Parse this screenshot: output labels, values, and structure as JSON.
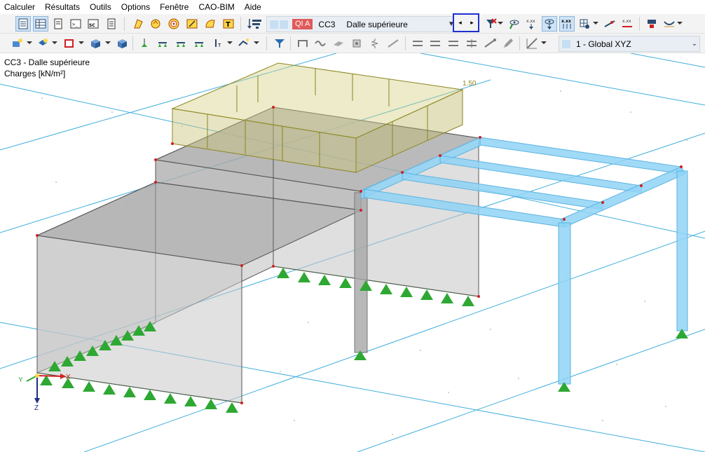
{
  "menu": [
    "Calculer",
    "Résultats",
    "Outils",
    "Options",
    "Fenêtre",
    "CAO-BIM",
    "Aide"
  ],
  "load_case": {
    "badge": "QI A",
    "code": "CC3",
    "name": "Dalle supérieure"
  },
  "coord_system": "1 - Global XYZ",
  "viewport": {
    "title": "CC3 - Dalle supérieure",
    "subtitle": "Charges [kN/m²]",
    "load_value": "1.50",
    "axis_labels": {
      "x": "X",
      "y": "Y",
      "z": "Z"
    }
  },
  "colors": {
    "load": "#b5b23a",
    "beam": "#8fd3f6",
    "wall": "#b8b8b8",
    "support": "#2ea832",
    "grid": "#2ba6d9",
    "nav_highlight": "#1f2fd0"
  },
  "icons": {
    "nav_prev": "◂",
    "nav_next": "▸"
  }
}
